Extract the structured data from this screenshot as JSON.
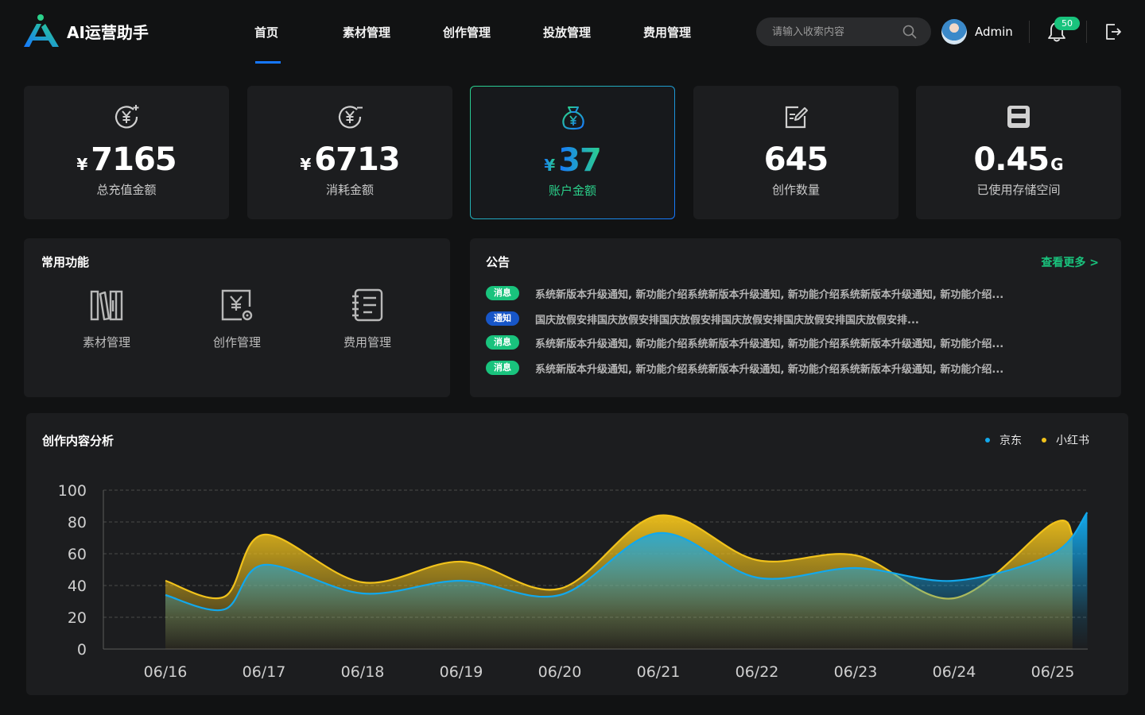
{
  "app": {
    "title": "AI运营助手"
  },
  "nav": [
    {
      "label": "首页",
      "active": true
    },
    {
      "label": "素材管理",
      "active": false
    },
    {
      "label": "创作管理",
      "active": false
    },
    {
      "label": "投放管理",
      "active": false
    },
    {
      "label": "费用管理",
      "active": false
    }
  ],
  "search": {
    "placeholder": "请输入收索内容",
    "value": ""
  },
  "user": {
    "name": "Admin"
  },
  "notifications": {
    "count": "50"
  },
  "colors": {
    "brand_green": "#19c37d",
    "brand_blue": "#1677ff",
    "series_jd": "#12a8ec",
    "series_xhs": "#f1c21b"
  },
  "stats": [
    {
      "icon": "yuan-plus-icon",
      "currency": "¥",
      "value": "7165",
      "unit": "",
      "label": "总充值金额"
    },
    {
      "icon": "yuan-minus-icon",
      "currency": "¥",
      "value": "6713",
      "unit": "",
      "label": "消耗金额"
    },
    {
      "icon": "money-bag-icon",
      "currency": "¥",
      "value": "37",
      "unit": "",
      "label": "账户金额"
    },
    {
      "icon": "edit-doc-icon",
      "currency": "",
      "value": "645",
      "unit": "",
      "label": "创作数量"
    },
    {
      "icon": "storage-icon",
      "currency": "",
      "value": "0.45",
      "unit": "G",
      "label": "已使用存储空间"
    }
  ],
  "quick": {
    "title": "常用功能",
    "items": [
      {
        "icon": "books-icon",
        "label": "素材管理"
      },
      {
        "icon": "creation-icon",
        "label": "创作管理"
      },
      {
        "icon": "ledger-icon",
        "label": "费用管理"
      }
    ]
  },
  "notice": {
    "title": "公告",
    "more": "查看更多 >",
    "items": [
      {
        "tag": "消息",
        "type": "msg",
        "text": "系统新版本升级通知, 新功能介绍系统新版本升级通知, 新功能介绍系统新版本升级通知, 新功能介绍..."
      },
      {
        "tag": "通知",
        "type": "info",
        "text": "国庆放假安排国庆放假安排国庆放假安排国庆放假安排国庆放假安排国庆放假安排..."
      },
      {
        "tag": "消息",
        "type": "msg",
        "text": "系统新版本升级通知, 新功能介绍系统新版本升级通知, 新功能介绍系统新版本升级通知, 新功能介绍..."
      },
      {
        "tag": "消息",
        "type": "msg",
        "text": "系统新版本升级通知, 新功能介绍系统新版本升级通知, 新功能介绍系统新版本升级通知, 新功能介绍..."
      }
    ]
  },
  "chart_data": {
    "type": "area",
    "title": "创作内容分析",
    "xlabel": "",
    "ylabel": "",
    "ylim": [
      0,
      100
    ],
    "yticks": [
      0,
      20,
      40,
      60,
      80,
      100
    ],
    "grid": true,
    "legend_position": "top-right",
    "x": [
      "06/16",
      "06/17",
      "06/18",
      "06/19",
      "06/20",
      "06/21",
      "06/22",
      "06/23",
      "06/24",
      "06/25"
    ],
    "series": [
      {
        "name": "京东",
        "color": "#12a8ec",
        "points": [
          [
            0,
            34
          ],
          [
            0.6,
            25
          ],
          [
            1.0,
            53
          ],
          [
            2.0,
            35
          ],
          [
            3.0,
            43
          ],
          [
            4.0,
            34
          ],
          [
            5.0,
            73
          ],
          [
            6.0,
            45
          ],
          [
            7.0,
            51
          ],
          [
            8.0,
            43
          ],
          [
            9.0,
            60
          ],
          [
            9.35,
            86
          ]
        ]
      },
      {
        "name": "小红书",
        "color": "#f1c21b",
        "points": [
          [
            0,
            43
          ],
          [
            0.6,
            33
          ],
          [
            1.0,
            72
          ],
          [
            2.0,
            42
          ],
          [
            3.0,
            55
          ],
          [
            4.0,
            38
          ],
          [
            5.0,
            84
          ],
          [
            6.0,
            56
          ],
          [
            7.0,
            59
          ],
          [
            8.0,
            32
          ],
          [
            9.0,
            79
          ],
          [
            9.2,
            72
          ]
        ]
      }
    ]
  }
}
